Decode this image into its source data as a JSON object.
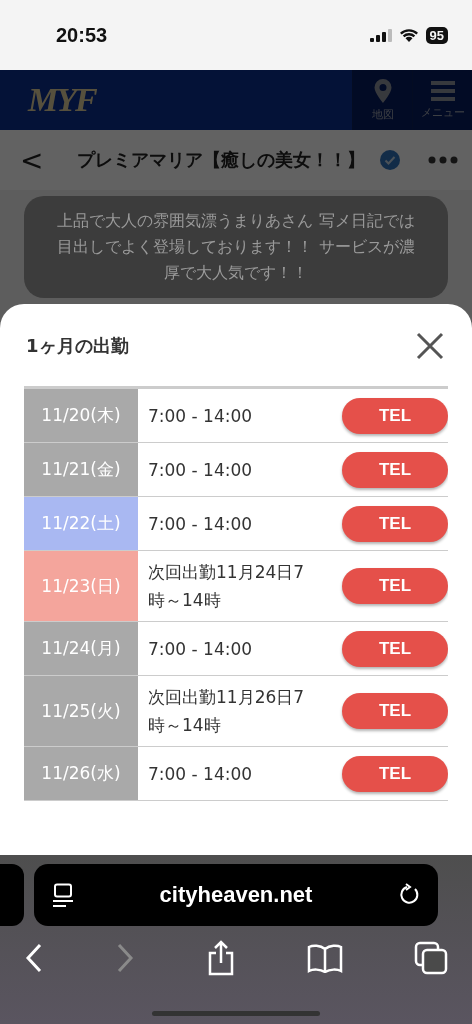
{
  "status_bar": {
    "time": "20:53",
    "battery": "95"
  },
  "site_header": {
    "logo": "MYF",
    "nav": [
      {
        "label": "地図"
      },
      {
        "label": "メニュー"
      }
    ]
  },
  "title_bar": {
    "back": "<",
    "title": "プレミアマリア【癒しの美女！！】",
    "verified": true
  },
  "description": "上品で大人の雰囲気漂うまりあさん 写メ日記では目出しでよく登場しております！！ サービスが濃厚で大人気です！！",
  "sheet": {
    "title": "1ヶ月の出勤",
    "rows": [
      {
        "date": "11/20(木)",
        "color": "#a9a9a9",
        "time": "7:00 - 14:00",
        "button": "TEL"
      },
      {
        "date": "11/21(金)",
        "color": "#a9a9a9",
        "time": "7:00 - 14:00",
        "button": "TEL"
      },
      {
        "date": "11/22(土)",
        "color": "#a9b8f2",
        "time": "7:00 - 14:00",
        "button": "TEL"
      },
      {
        "date": "11/23(日)",
        "color": "#f4a59c",
        "time": "次回出勤11月24日7時～14時",
        "button": "TEL"
      },
      {
        "date": "11/24(月)",
        "color": "#a9a9a9",
        "time": "7:00 - 14:00",
        "button": "TEL"
      },
      {
        "date": "11/25(火)",
        "color": "#a9a9a9",
        "time": "次回出勤11月26日7時～14時",
        "button": "TEL"
      },
      {
        "date": "11/26(水)",
        "color": "#a9a9a9",
        "time": "7:00 - 14:00",
        "button": "TEL"
      }
    ]
  },
  "browser": {
    "url": "cityheaven.net"
  }
}
